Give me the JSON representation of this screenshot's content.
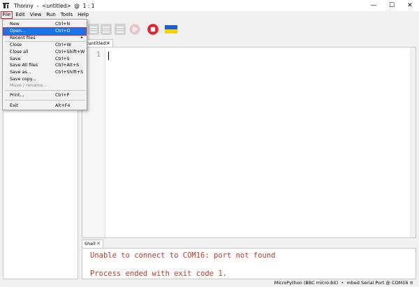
{
  "window": {
    "title": "Thonny  -  <untitled>  @  1 : 1",
    "controls": {
      "minimize": "—",
      "maximize": "☐",
      "close": "✕"
    }
  },
  "menubar": [
    "File",
    "Edit",
    "View",
    "Run",
    "Tools",
    "Help"
  ],
  "toolbar": {
    "buttons": [
      "step-over",
      "step-into",
      "step-out",
      "resume",
      "stop",
      "ukraine-flag"
    ],
    "colors": {
      "stop": "#e0242b",
      "flag_blue": "#1f5fc9",
      "flag_yellow": "#f5d300"
    }
  },
  "file_menu": {
    "items": [
      {
        "label": "New",
        "shortcut": "Ctrl+N",
        "enabled": true
      },
      {
        "label": "Open...",
        "shortcut": "Ctrl+O",
        "enabled": true,
        "highlighted": true
      },
      {
        "label": "Recent files",
        "shortcut": "",
        "enabled": true,
        "submenu": true
      },
      {
        "label": "Close",
        "shortcut": "Ctrl+W",
        "enabled": true
      },
      {
        "label": "Close all",
        "shortcut": "Ctrl+Shift+W",
        "enabled": true
      },
      {
        "label": "Save",
        "shortcut": "Ctrl+S",
        "enabled": true
      },
      {
        "label": "Save All files",
        "shortcut": "Ctrl+Alt+S",
        "enabled": true
      },
      {
        "label": "Save as...",
        "shortcut": "Ctrl+Shift+S",
        "enabled": true
      },
      {
        "label": "Save copy...",
        "shortcut": "",
        "enabled": true
      },
      {
        "label": "Move / rename...",
        "shortcut": "",
        "enabled": false
      },
      {
        "label": "Print...",
        "shortcut": "Ctrl+P",
        "enabled": true
      },
      {
        "label": "Exit",
        "shortcut": "Alt+F4",
        "enabled": true
      }
    ],
    "submenu_arrow": "▸"
  },
  "editor": {
    "tab_label": "<untitled>",
    "tab_close": "✕",
    "line_number": "1"
  },
  "shell": {
    "tab_label": "Shell",
    "tab_close": "✕",
    "lines": [
      "Unable to connect to COM16: port not found",
      "Process ended with exit code 1."
    ]
  },
  "status": {
    "text": "MicroPython (BBC micro:bit)  •  mbed Serial Port @ COM16 ≡"
  }
}
